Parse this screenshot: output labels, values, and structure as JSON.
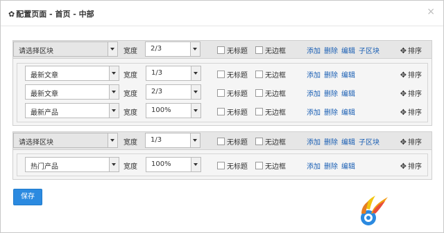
{
  "dialog": {
    "title": "配置页面 - 首页 - 中部",
    "close_label": "×"
  },
  "labels": {
    "width": "宽度",
    "no_title": "无标题",
    "no_border": "无边框",
    "add": "添加",
    "delete": "删除",
    "edit": "编辑",
    "sub_block": "子区块",
    "sort": "排序"
  },
  "blocks": [
    {
      "module": "请选择区块",
      "width": "2/3",
      "children": [
        {
          "module": "最新文章",
          "width": "1/3"
        },
        {
          "module": "最新文章",
          "width": "2/3"
        },
        {
          "module": "最新产品",
          "width": "100%"
        }
      ]
    },
    {
      "module": "请选择区块",
      "width": "1/3",
      "children": [
        {
          "module": "热门产品",
          "width": "100%"
        }
      ]
    }
  ],
  "footer": {
    "save_label": "保存"
  },
  "colors": {
    "accent": "#2b8ae0",
    "link": "#1a5fb4"
  }
}
